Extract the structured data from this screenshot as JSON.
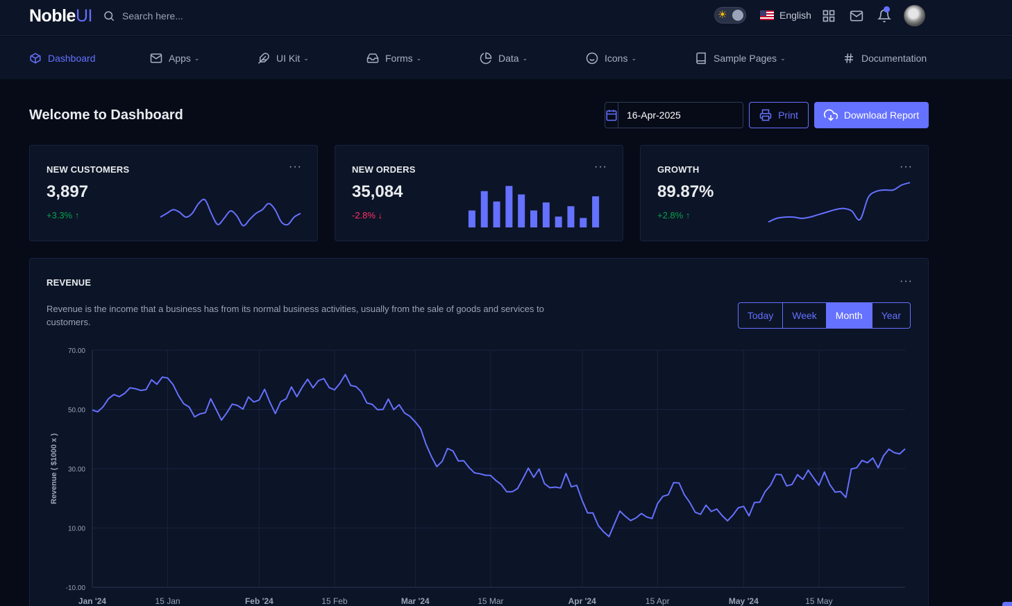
{
  "brand": {
    "name": "Noble",
    "suffix": "UI"
  },
  "search": {
    "placeholder": "Search here..."
  },
  "topbar": {
    "language": "English",
    "icons": [
      "sun-icon",
      "us-flag-icon",
      "grid-icon",
      "mail-icon",
      "bell-icon",
      "avatar"
    ]
  },
  "nav": {
    "items": [
      {
        "label": "Dashboard",
        "icon": "box-icon",
        "active": true,
        "dropdown": false
      },
      {
        "label": "Apps",
        "icon": "mail-icon",
        "dropdown": true
      },
      {
        "label": "UI Kit",
        "icon": "feather-icon",
        "dropdown": true
      },
      {
        "label": "Forms",
        "icon": "inbox-icon",
        "dropdown": true
      },
      {
        "label": "Data",
        "icon": "pie-chart-icon",
        "dropdown": true
      },
      {
        "label": "Icons",
        "icon": "smile-icon",
        "dropdown": true
      },
      {
        "label": "Sample Pages",
        "icon": "book-icon",
        "dropdown": true
      },
      {
        "label": "Documentation",
        "icon": "hash-icon",
        "dropdown": false
      }
    ]
  },
  "header": {
    "title": "Welcome to Dashboard",
    "date_value": "16-Apr-2025",
    "print_label": "Print",
    "download_label": "Download Report"
  },
  "stats": [
    {
      "title": "NEW CUSTOMERS",
      "value": "3,897",
      "change": "+3.3%",
      "trend": "up"
    },
    {
      "title": "NEW ORDERS",
      "value": "35,084",
      "change": "-2.8%",
      "trend": "down"
    },
    {
      "title": "GROWTH",
      "value": "89.87%",
      "change": "+2.8%",
      "trend": "up"
    }
  ],
  "revenue": {
    "title": "REVENUE",
    "description": "Revenue is the income that a business has from its normal business activities, usually from the sale of goods and services to customers.",
    "ranges": [
      "Today",
      "Week",
      "Month",
      "Year"
    ],
    "active_range": "Month"
  },
  "colors": {
    "accent": "#6571ff",
    "up": "#05a34a",
    "down": "#ff3366",
    "background": "#070b18",
    "card": "#0c1427"
  },
  "chart_data": [
    {
      "type": "line",
      "title": "NEW CUSTOMERS sparkline",
      "values": [
        44,
        47,
        50,
        48,
        44,
        47,
        55,
        58,
        47,
        38,
        43,
        49,
        45,
        37,
        42,
        47,
        50,
        55,
        50,
        40,
        38,
        44,
        47
      ]
    },
    {
      "type": "bar",
      "title": "NEW ORDERS sparkline",
      "values": [
        36,
        77,
        55,
        88,
        70,
        36,
        53,
        23,
        45,
        20,
        66
      ]
    },
    {
      "type": "line",
      "title": "GROWTH sparkline",
      "values": [
        40,
        43,
        44,
        44,
        43,
        44,
        46,
        48,
        50,
        51,
        49,
        42,
        60,
        65,
        66,
        66,
        70,
        72
      ]
    },
    {
      "type": "line",
      "title": "",
      "xlabel": "",
      "ylabel": "Revenue ( $1000 x )",
      "ylim": [
        -10,
        70
      ],
      "y_ticks": [
        "70.00",
        "50.00",
        "30.00",
        "10.00",
        "-10.00"
      ],
      "x_ticks": [
        "Jan '24",
        "15 Jan",
        "Feb '24",
        "15 Feb",
        "Mar '24",
        "15 Mar",
        "Apr '24",
        "15 Apr",
        "May '24",
        "15 May"
      ],
      "x_tick_bold": [
        true,
        false,
        true,
        false,
        true,
        false,
        true,
        false,
        true,
        false
      ],
      "x_range": [
        "2024-01-01",
        "2024-05-31"
      ],
      "series": [
        {
          "name": "Revenue",
          "x": [
            "2024-01-01",
            "2024-01-02",
            "2024-01-03",
            "2024-01-04",
            "2024-01-05",
            "2024-01-06",
            "2024-01-07",
            "2024-01-08",
            "2024-01-09",
            "2024-01-10",
            "2024-01-11",
            "2024-01-12",
            "2024-01-13",
            "2024-01-14",
            "2024-01-15",
            "2024-01-16",
            "2024-01-17",
            "2024-01-18",
            "2024-01-19",
            "2024-01-20",
            "2024-01-21",
            "2024-01-22",
            "2024-01-23",
            "2024-01-24",
            "2024-01-25",
            "2024-01-26",
            "2024-01-27",
            "2024-01-28",
            "2024-01-29",
            "2024-01-30",
            "2024-01-31",
            "2024-02-01",
            "2024-02-02",
            "2024-02-03",
            "2024-02-04",
            "2024-02-05",
            "2024-02-06",
            "2024-02-07",
            "2024-02-08",
            "2024-02-09",
            "2024-02-10",
            "2024-02-11",
            "2024-02-12",
            "2024-02-13",
            "2024-02-14",
            "2024-02-15",
            "2024-02-16",
            "2024-02-17",
            "2024-02-18",
            "2024-02-19",
            "2024-02-20",
            "2024-02-21",
            "2024-02-22",
            "2024-02-23",
            "2024-02-24",
            "2024-02-25",
            "2024-02-26",
            "2024-02-27",
            "2024-02-28",
            "2024-02-29",
            "2024-03-01",
            "2024-03-02",
            "2024-03-03",
            "2024-03-04",
            "2024-03-05",
            "2024-03-06",
            "2024-03-07",
            "2024-03-08",
            "2024-03-09",
            "2024-03-10",
            "2024-03-11",
            "2024-03-12",
            "2024-03-13",
            "2024-03-14",
            "2024-03-15",
            "2024-03-16",
            "2024-03-17",
            "2024-03-18",
            "2024-03-19",
            "2024-03-20",
            "2024-03-21",
            "2024-03-22",
            "2024-03-23",
            "2024-03-24",
            "2024-03-25",
            "2024-03-26",
            "2024-03-27",
            "2024-03-28",
            "2024-03-29",
            "2024-03-30",
            "2024-03-31",
            "2024-04-01",
            "2024-04-02",
            "2024-04-03",
            "2024-04-04",
            "2024-04-05",
            "2024-04-06",
            "2024-04-07",
            "2024-04-08",
            "2024-04-09",
            "2024-04-10",
            "2024-04-11",
            "2024-04-12",
            "2024-04-13",
            "2024-04-14",
            "2024-04-15",
            "2024-04-16",
            "2024-04-17",
            "2024-04-18",
            "2024-04-19",
            "2024-04-20",
            "2024-04-21",
            "2024-04-22",
            "2024-04-23",
            "2024-04-24",
            "2024-04-25",
            "2024-04-26",
            "2024-04-27",
            "2024-04-28",
            "2024-04-29",
            "2024-04-30",
            "2024-05-01",
            "2024-05-02",
            "2024-05-03",
            "2024-05-04",
            "2024-05-05",
            "2024-05-06",
            "2024-05-07",
            "2024-05-08",
            "2024-05-09",
            "2024-05-10",
            "2024-05-11",
            "2024-05-12",
            "2024-05-13",
            "2024-05-14",
            "2024-05-15",
            "2024-05-16",
            "2024-05-17",
            "2024-05-18",
            "2024-05-19",
            "2024-05-20",
            "2024-05-21",
            "2024-05-22",
            "2024-05-23",
            "2024-05-24",
            "2024-05-25",
            "2024-05-26",
            "2024-05-27",
            "2024-05-28",
            "2024-05-29",
            "2024-05-30",
            "2024-05-31"
          ],
          "values": [
            49.8,
            49.2,
            50.9,
            53.6,
            55.0,
            54.3,
            55.4,
            57.3,
            57.0,
            56.4,
            56.7,
            60.0,
            58.5,
            60.9,
            60.6,
            58.4,
            54.7,
            51.9,
            50.8,
            47.5,
            48.5,
            48.9,
            53.6,
            50.0,
            46.4,
            48.9,
            51.8,
            51.3,
            50.1,
            54.2,
            52.5,
            53.2,
            56.8,
            52.4,
            48.6,
            52.6,
            53.6,
            57.6,
            54.3,
            57.5,
            60.2,
            57.3,
            59.7,
            60.4,
            57.4,
            56.6,
            58.8,
            61.8,
            58.1,
            57.7,
            55.9,
            52.2,
            51.7,
            49.9,
            50.0,
            53.5,
            49.9,
            51.6,
            48.8,
            47.7,
            45.8,
            43.5,
            38.2,
            34.1,
            30.7,
            32.5,
            36.8,
            36.0,
            32.6,
            32.7,
            30.4,
            28.6,
            28.3,
            27.8,
            27.7,
            26.0,
            24.6,
            22.2,
            22.2,
            23.3,
            26.6,
            30.2,
            27.1,
            29.9,
            25.0,
            23.6,
            23.8,
            23.5,
            28.4,
            23.9,
            24.4,
            19.3,
            15.1,
            15.1,
            10.8,
            8.7,
            7.1,
            11.4,
            15.7,
            14.0,
            12.5,
            13.4,
            14.9,
            13.7,
            13.2,
            18.2,
            20.7,
            21.2,
            25.3,
            25.2,
            21.2,
            18.6,
            15.3,
            14.6,
            17.7,
            15.6,
            16.4,
            14.2,
            12.4,
            14.3,
            16.8,
            17.3,
            14.1,
            18.6,
            18.7,
            22.3,
            24.4,
            28.1,
            28.0,
            24.2,
            24.7,
            28.0,
            26.4,
            29.5,
            26.9,
            24.4,
            28.9,
            24.7,
            22.1,
            22.3,
            20.3,
            29.9,
            30.3,
            32.8,
            32.0,
            33.6,
            30.3,
            34.4,
            36.6,
            35.4,
            35.0,
            36.7
          ]
        }
      ]
    }
  ]
}
